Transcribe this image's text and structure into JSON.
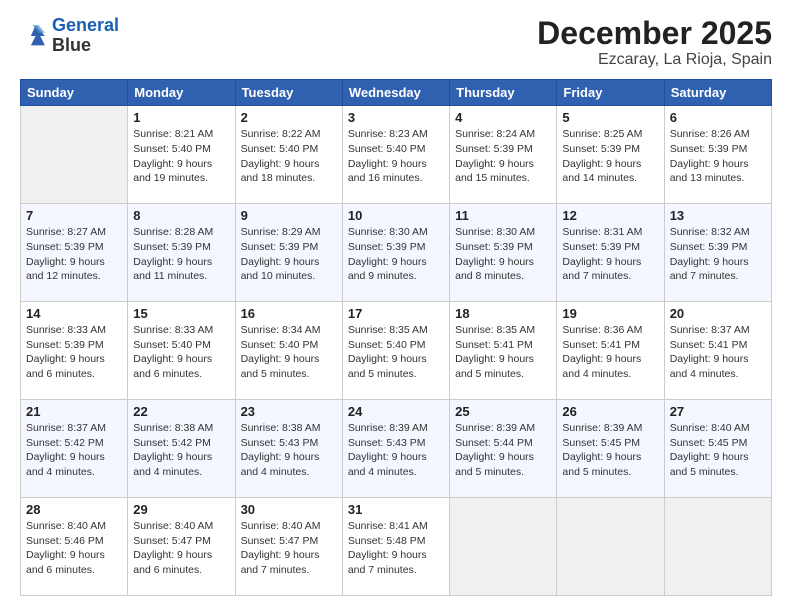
{
  "header": {
    "logo_line1": "General",
    "logo_line2": "Blue",
    "month": "December 2025",
    "location": "Ezcaray, La Rioja, Spain"
  },
  "weekdays": [
    "Sunday",
    "Monday",
    "Tuesday",
    "Wednesday",
    "Thursday",
    "Friday",
    "Saturday"
  ],
  "weeks": [
    [
      {
        "day": "",
        "info": ""
      },
      {
        "day": "1",
        "info": "Sunrise: 8:21 AM\nSunset: 5:40 PM\nDaylight: 9 hours\nand 19 minutes."
      },
      {
        "day": "2",
        "info": "Sunrise: 8:22 AM\nSunset: 5:40 PM\nDaylight: 9 hours\nand 18 minutes."
      },
      {
        "day": "3",
        "info": "Sunrise: 8:23 AM\nSunset: 5:40 PM\nDaylight: 9 hours\nand 16 minutes."
      },
      {
        "day": "4",
        "info": "Sunrise: 8:24 AM\nSunset: 5:39 PM\nDaylight: 9 hours\nand 15 minutes."
      },
      {
        "day": "5",
        "info": "Sunrise: 8:25 AM\nSunset: 5:39 PM\nDaylight: 9 hours\nand 14 minutes."
      },
      {
        "day": "6",
        "info": "Sunrise: 8:26 AM\nSunset: 5:39 PM\nDaylight: 9 hours\nand 13 minutes."
      }
    ],
    [
      {
        "day": "7",
        "info": "Sunrise: 8:27 AM\nSunset: 5:39 PM\nDaylight: 9 hours\nand 12 minutes."
      },
      {
        "day": "8",
        "info": "Sunrise: 8:28 AM\nSunset: 5:39 PM\nDaylight: 9 hours\nand 11 minutes."
      },
      {
        "day": "9",
        "info": "Sunrise: 8:29 AM\nSunset: 5:39 PM\nDaylight: 9 hours\nand 10 minutes."
      },
      {
        "day": "10",
        "info": "Sunrise: 8:30 AM\nSunset: 5:39 PM\nDaylight: 9 hours\nand 9 minutes."
      },
      {
        "day": "11",
        "info": "Sunrise: 8:30 AM\nSunset: 5:39 PM\nDaylight: 9 hours\nand 8 minutes."
      },
      {
        "day": "12",
        "info": "Sunrise: 8:31 AM\nSunset: 5:39 PM\nDaylight: 9 hours\nand 7 minutes."
      },
      {
        "day": "13",
        "info": "Sunrise: 8:32 AM\nSunset: 5:39 PM\nDaylight: 9 hours\nand 7 minutes."
      }
    ],
    [
      {
        "day": "14",
        "info": "Sunrise: 8:33 AM\nSunset: 5:39 PM\nDaylight: 9 hours\nand 6 minutes."
      },
      {
        "day": "15",
        "info": "Sunrise: 8:33 AM\nSunset: 5:40 PM\nDaylight: 9 hours\nand 6 minutes."
      },
      {
        "day": "16",
        "info": "Sunrise: 8:34 AM\nSunset: 5:40 PM\nDaylight: 9 hours\nand 5 minutes."
      },
      {
        "day": "17",
        "info": "Sunrise: 8:35 AM\nSunset: 5:40 PM\nDaylight: 9 hours\nand 5 minutes."
      },
      {
        "day": "18",
        "info": "Sunrise: 8:35 AM\nSunset: 5:41 PM\nDaylight: 9 hours\nand 5 minutes."
      },
      {
        "day": "19",
        "info": "Sunrise: 8:36 AM\nSunset: 5:41 PM\nDaylight: 9 hours\nand 4 minutes."
      },
      {
        "day": "20",
        "info": "Sunrise: 8:37 AM\nSunset: 5:41 PM\nDaylight: 9 hours\nand 4 minutes."
      }
    ],
    [
      {
        "day": "21",
        "info": "Sunrise: 8:37 AM\nSunset: 5:42 PM\nDaylight: 9 hours\nand 4 minutes."
      },
      {
        "day": "22",
        "info": "Sunrise: 8:38 AM\nSunset: 5:42 PM\nDaylight: 9 hours\nand 4 minutes."
      },
      {
        "day": "23",
        "info": "Sunrise: 8:38 AM\nSunset: 5:43 PM\nDaylight: 9 hours\nand 4 minutes."
      },
      {
        "day": "24",
        "info": "Sunrise: 8:39 AM\nSunset: 5:43 PM\nDaylight: 9 hours\nand 4 minutes."
      },
      {
        "day": "25",
        "info": "Sunrise: 8:39 AM\nSunset: 5:44 PM\nDaylight: 9 hours\nand 5 minutes."
      },
      {
        "day": "26",
        "info": "Sunrise: 8:39 AM\nSunset: 5:45 PM\nDaylight: 9 hours\nand 5 minutes."
      },
      {
        "day": "27",
        "info": "Sunrise: 8:40 AM\nSunset: 5:45 PM\nDaylight: 9 hours\nand 5 minutes."
      }
    ],
    [
      {
        "day": "28",
        "info": "Sunrise: 8:40 AM\nSunset: 5:46 PM\nDaylight: 9 hours\nand 6 minutes."
      },
      {
        "day": "29",
        "info": "Sunrise: 8:40 AM\nSunset: 5:47 PM\nDaylight: 9 hours\nand 6 minutes."
      },
      {
        "day": "30",
        "info": "Sunrise: 8:40 AM\nSunset: 5:47 PM\nDaylight: 9 hours\nand 7 minutes."
      },
      {
        "day": "31",
        "info": "Sunrise: 8:41 AM\nSunset: 5:48 PM\nDaylight: 9 hours\nand 7 minutes."
      },
      {
        "day": "",
        "info": ""
      },
      {
        "day": "",
        "info": ""
      },
      {
        "day": "",
        "info": ""
      }
    ]
  ]
}
